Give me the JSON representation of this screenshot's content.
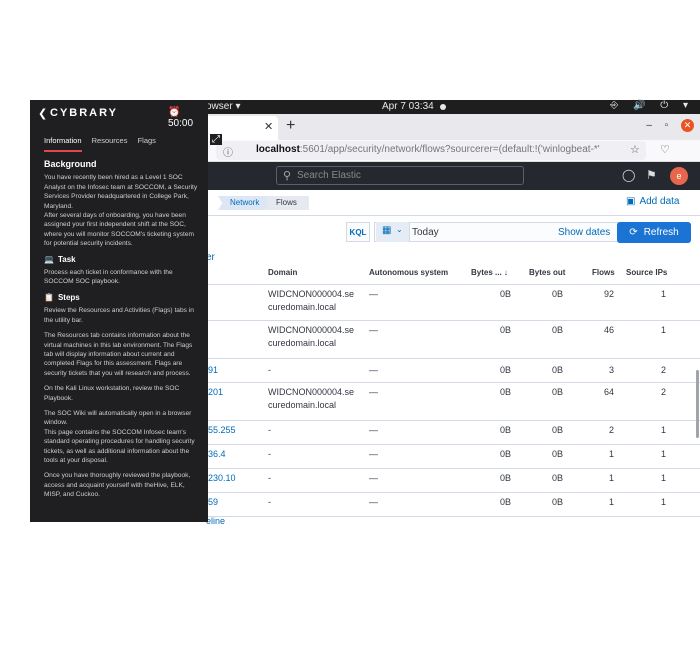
{
  "topbar": {
    "app_label": "owser ▾",
    "clock": "Apr 7  03:34",
    "tray": "⎆ 🔊 ⏻ ▾"
  },
  "browser": {
    "tab_close": "✕",
    "new_tab": "+",
    "url_host": "localhost",
    "url_rest": ":5601/app/security/network/flows?sourcerer=(default:!('winlogbeat-*'",
    "win_min": "–",
    "win_max": "▫",
    "win_close": "✕"
  },
  "kibana": {
    "search_placeholder": "Search Elastic",
    "avatar": "e",
    "breadcrumbs": [
      "Network",
      "Flows"
    ],
    "add_data": "Add data",
    "kql": "KQL",
    "date_value": "Today",
    "show_dates": "Show dates",
    "refresh": "Refresh",
    "partial_link": "er",
    "bottom_partial": "eline"
  },
  "table": {
    "headers": [
      "Domain",
      "Autonomous system",
      "Bytes ...",
      "Bytes out",
      "Flows",
      "Source IPs"
    ],
    "rows": [
      {
        "ip": "",
        "domain": [
          "WIDCNON000004.se",
          "curedomain.local"
        ],
        "as": "—",
        "bytes_in": "0B",
        "bytes_out": "0B",
        "flows": "92",
        "source_ips": "1"
      },
      {
        "ip": "",
        "domain": [
          "WIDCNON000004.se",
          "curedomain.local"
        ],
        "as": "—",
        "bytes_in": "0B",
        "bytes_out": "0B",
        "flows": "46",
        "source_ips": "1"
      },
      {
        "ip": "91",
        "domain": [
          "-"
        ],
        "as": "—",
        "bytes_in": "0B",
        "bytes_out": "0B",
        "flows": "3",
        "source_ips": "2"
      },
      {
        "ip": "201",
        "domain": [
          "WIDCNON000004.se",
          "curedomain.local"
        ],
        "as": "—",
        "bytes_in": "0B",
        "bytes_out": "0B",
        "flows": "64",
        "source_ips": "2"
      },
      {
        "ip": "55.255",
        "domain": [
          "-"
        ],
        "as": "—",
        "bytes_in": "0B",
        "bytes_out": "0B",
        "flows": "2",
        "source_ips": "1"
      },
      {
        "ip": "36.4",
        "domain": [
          "-"
        ],
        "as": "—",
        "bytes_in": "0B",
        "bytes_out": "0B",
        "flows": "1",
        "source_ips": "1"
      },
      {
        "ip": "230.10",
        "domain": [
          "-"
        ],
        "as": "—",
        "bytes_in": "0B",
        "bytes_out": "0B",
        "flows": "1",
        "source_ips": "1"
      },
      {
        "ip": "59",
        "domain": [
          "-"
        ],
        "as": "—",
        "bytes_in": "0B",
        "bytes_out": "0B",
        "flows": "1",
        "source_ips": "1"
      }
    ]
  },
  "sidebar": {
    "logo": "CYBRARY",
    "timer": "50:00",
    "tabs": [
      "Information",
      "Resources",
      "Flags"
    ],
    "background_title": "Background",
    "background_p1": "You have recently been hired as a Level 1 SOC Analyst on the Infosec team at SOCCOM, a Security Services Provider headquartered in College Park, Maryland.",
    "background_p2": "After several days of onboarding, you have been assigned your first independent shift at the SOC, where you will monitor SOCCOM's ticketing system for potential security incidents.",
    "task_title": "Task",
    "task_p": "Process each ticket in conformance with the SOCCOM SOC playbook.",
    "steps_title": "Steps",
    "steps_p1": "Review the Resources and Activities (Flags) tabs in the utility bar.",
    "steps_p2": "The Resources tab contains information about the virtual machines in this lab environment. The Flags tab will display information about current and completed Flags for this assessment. Flags are security tickets that you will research and process.",
    "steps_p3": "On the Kali Linux workstation, review the SOC Playbook.",
    "steps_p4": "The SOC Wiki will automatically open in a browser window.",
    "steps_p5": "This page contains the SOCCOM Infosec team's standard operating procedures for handling security tickets, as well as additional information about the tools at your disposal.",
    "steps_p6": "Once you have thoroughly reviewed the playbook, access and acquaint yourself with theHive, ELK, MISP, and Cuckoo."
  }
}
